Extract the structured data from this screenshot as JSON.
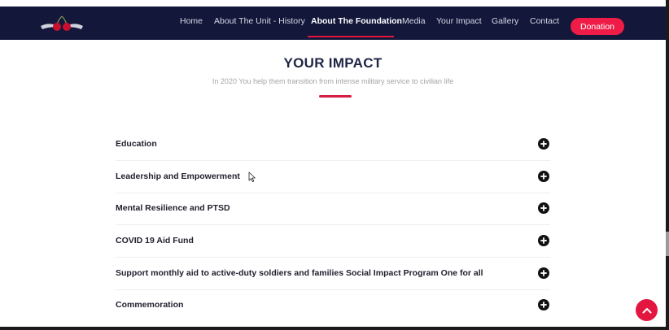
{
  "nav": {
    "items": [
      {
        "label": "Home"
      },
      {
        "label": "About The Unit - History"
      },
      {
        "label": "About The Foundation",
        "active": true
      },
      {
        "label": "Media"
      },
      {
        "label": "Your Impact"
      },
      {
        "label": "Gallery"
      },
      {
        "label": "Contact"
      }
    ],
    "donate_label": "Donation"
  },
  "section": {
    "title": "YOUR IMPACT",
    "subtitle": "In 2020 You help them transition from intense military service to civilian life"
  },
  "accordion": [
    {
      "label": "Education"
    },
    {
      "label": "Leadership and Empowerment"
    },
    {
      "label": "Mental Resilience and PTSD"
    },
    {
      "label": "COVID 19 Aid Fund"
    },
    {
      "label": "Support monthly aid to active-duty soldiers and families Social Impact Program One for all"
    },
    {
      "label": "Commemoration"
    }
  ],
  "icons": {
    "logo": "cherry-wings-logo",
    "expand": "plus-circle-icon",
    "back_to_top": "chevron-up-icon",
    "cursor": "mouse-pointer-icon"
  },
  "colors": {
    "nav_bg": "#13173a",
    "accent": "#ee1c47",
    "title": "#1f2545"
  }
}
